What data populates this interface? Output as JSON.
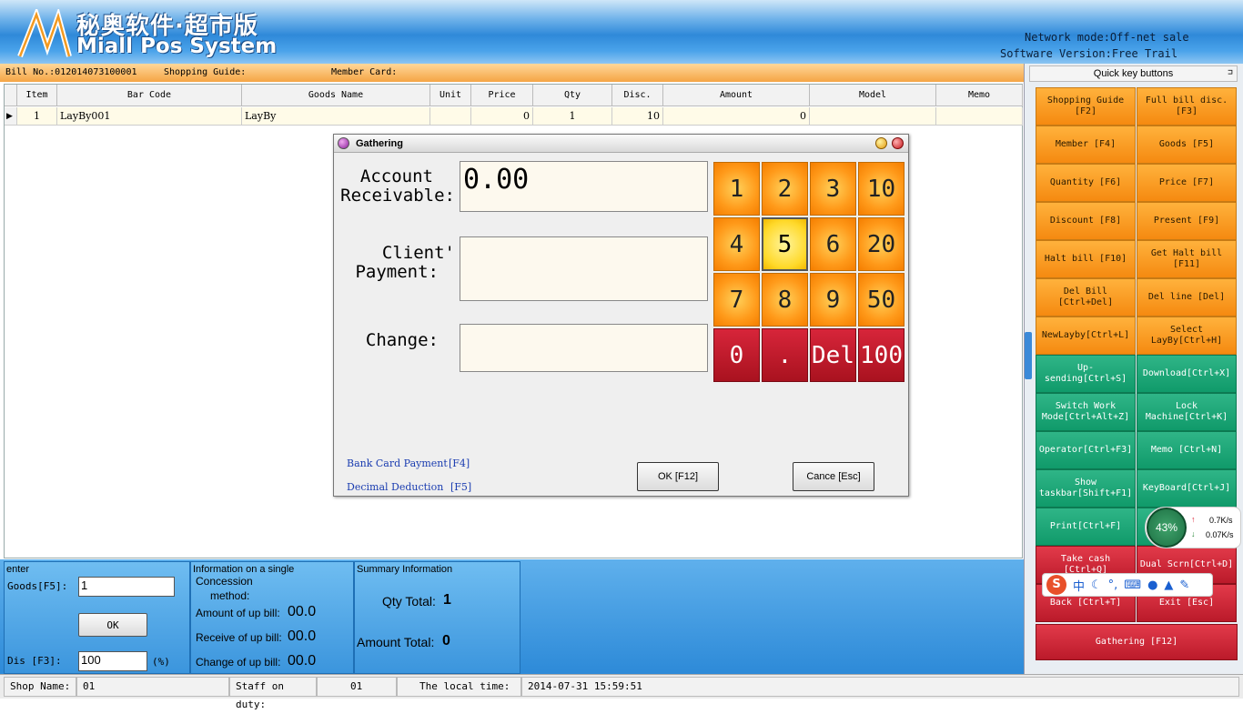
{
  "header": {
    "logo_cn": "秘奥软件·超市版",
    "logo_en": "Miall Pos System",
    "network_mode": "Network mode:Off-net sale",
    "software_version": "Software Version:Free Trail"
  },
  "bill_bar": {
    "bill_no": "Bill No.:012014073100001",
    "shopping_guide": "Shopping Guide:",
    "member_card": "Member Card:"
  },
  "table": {
    "columns": [
      "Item",
      "Bar Code",
      "Goods Name",
      "Unit",
      "Price",
      "Qty",
      "Disc.",
      "Amount",
      "Model",
      "Memo"
    ],
    "rows": [
      {
        "item": "1",
        "bar_code": "LayBy001",
        "goods_name": "LayBy",
        "unit": "",
        "price": "0",
        "qty": "1",
        "disc": "10",
        "amount": "0",
        "model": "",
        "memo": ""
      }
    ]
  },
  "quick_keys": {
    "title": "Quick key buttons",
    "pin": "中",
    "buttons": [
      {
        "label": "Shopping Guide [F2]",
        "color": "orange"
      },
      {
        "label": "Full bill disc. [F3]",
        "color": "orange"
      },
      {
        "label": "Member [F4]",
        "color": "orange"
      },
      {
        "label": "Goods [F5]",
        "color": "orange"
      },
      {
        "label": "Quantity [F6]",
        "color": "orange"
      },
      {
        "label": "Price [F7]",
        "color": "orange"
      },
      {
        "label": "Discount [F8]",
        "color": "orange"
      },
      {
        "label": "Present [F9]",
        "color": "orange"
      },
      {
        "label": "Halt bill [F10]",
        "color": "orange"
      },
      {
        "label": "Get Halt bill [F11]",
        "color": "orange"
      },
      {
        "label": "Del Bill [Ctrl+Del]",
        "color": "orange"
      },
      {
        "label": "Del line [Del]",
        "color": "orange"
      },
      {
        "label": "NewLayby[Ctrl+L]",
        "color": "orange"
      },
      {
        "label": "Select LayBy[Ctrl+H]",
        "color": "orange"
      },
      {
        "label": "Up-sending[Ctrl+S]",
        "color": "green"
      },
      {
        "label": "Download[Ctrl+X]",
        "color": "green"
      },
      {
        "label": "Switch Work Mode[Ctrl+Alt+Z]",
        "color": "green"
      },
      {
        "label": "Lock Machine[Ctrl+K]",
        "color": "green"
      },
      {
        "label": "Operator[Ctrl+F3]",
        "color": "green"
      },
      {
        "label": "Memo [Ctrl+N]",
        "color": "green"
      },
      {
        "label": "Show taskbar[Shift+F1]",
        "color": "green"
      },
      {
        "label": "KeyBoard[Ctrl+J]",
        "color": "green"
      },
      {
        "label": "Print[Ctrl+F]",
        "color": "green"
      },
      {
        "label": "",
        "color": "green"
      },
      {
        "label": "Take cash [Ctrl+Q]",
        "color": "red"
      },
      {
        "label": "Dual Scrn[Ctrl+D]",
        "color": "red"
      },
      {
        "label": "Back [Ctrl+T]",
        "color": "red"
      },
      {
        "label": "Exit [Esc]",
        "color": "red"
      }
    ],
    "gathering": "Gathering [F12]"
  },
  "bottom": {
    "enter_title": "enter",
    "goods_label": "Goods[F5]:",
    "goods_value": "1",
    "ok_label": "OK",
    "dis_label": "Dis [F3]:",
    "dis_value": "100",
    "dis_unit": "(%)",
    "single_title": "Information on a single",
    "concession_label": "Concession",
    "method_label": "method:",
    "amount_up_label": "Amount of up bill:",
    "amount_up_value": "00.0",
    "receive_up_label": "Receive of up bill:",
    "receive_up_value": "00.0",
    "change_up_label": "Change of up bill:",
    "change_up_value": "00.0",
    "summary_title": "Summary Information",
    "qty_total_label": "Qty Total:",
    "qty_total_value": "1",
    "amount_total_label": "Amount Total:",
    "amount_total_value": "0"
  },
  "status_bar": {
    "shop_name_label": "Shop Name:",
    "shop_name_value": "01",
    "staff_label": "Staff on duty:",
    "staff_value": "01",
    "time_label": "The local time:",
    "time_value": "2014-07-31 15:59:51"
  },
  "dialog": {
    "title": "Gathering",
    "account_label_1": "Account",
    "account_label_2": "Receivable:",
    "account_value": "0.00",
    "client_label_1": "Client'",
    "client_label_2": "Payment:",
    "client_value": "",
    "change_label": "Change:",
    "change_value": "",
    "keypad": [
      "1",
      "2",
      "3",
      "10",
      "4",
      "5",
      "6",
      "20",
      "7",
      "8",
      "9",
      "50",
      "0",
      ".",
      "Del",
      "100"
    ],
    "bank_card_label": "Bank Card Payment",
    "bank_card_key": "[F4]",
    "decimal_label": "Decimal Deduction",
    "decimal_key": "[F5]",
    "ok_label": "OK [F12]",
    "cancel_label": "Cance [Esc]"
  },
  "overlays": {
    "speed_percent": "43%",
    "upload_speed": "0.7K/s",
    "download_speed": "0.07K/s",
    "ime_label": "中"
  },
  "colors": {
    "orange_key": "#f58a10",
    "green_key": "#109a6a",
    "red_key": "#bb1a2a",
    "header_blue": "#2f89d9"
  }
}
